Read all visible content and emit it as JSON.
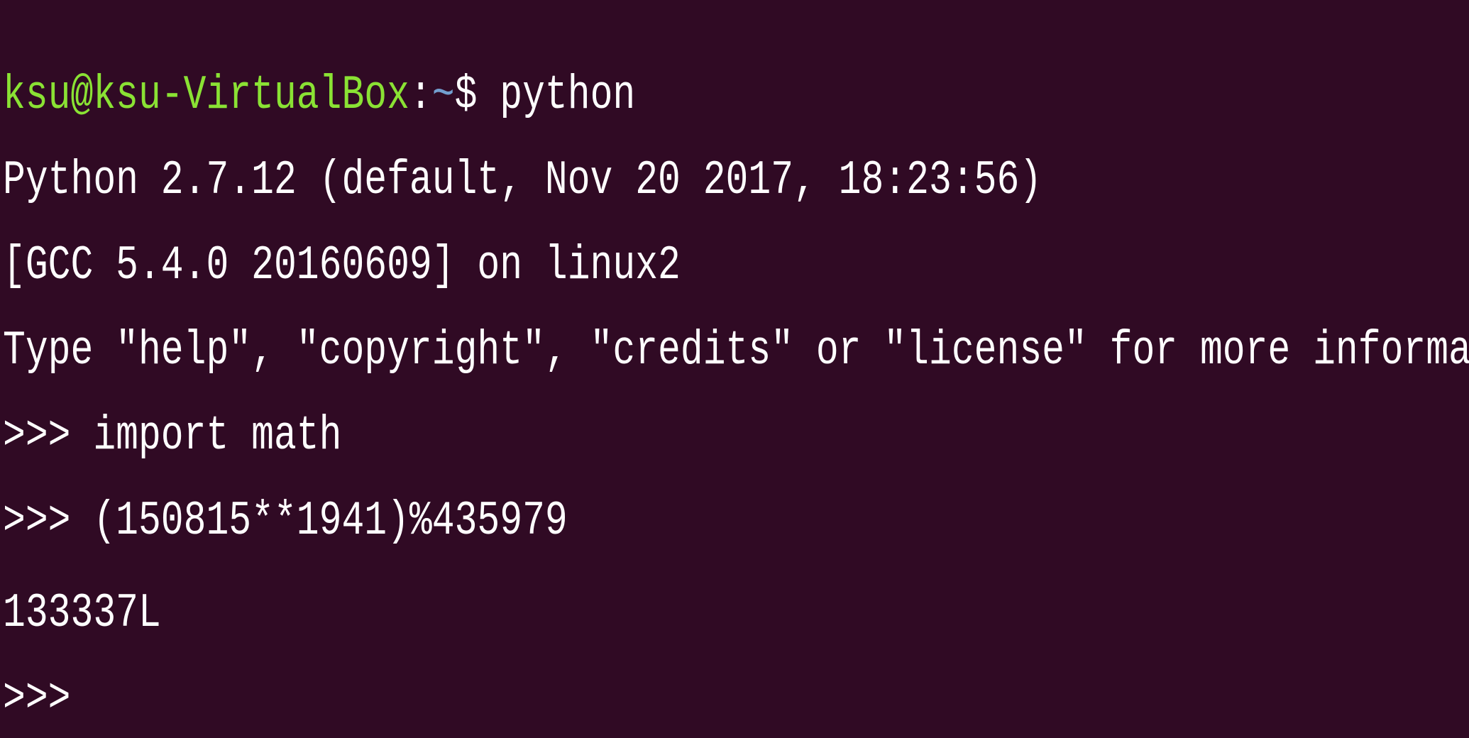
{
  "terminal": {
    "background": "#300a24",
    "prompt": {
      "user_host": "ksu@ksu-VirtualBox",
      "colon": ":",
      "path": "~",
      "dollar": "$ ",
      "command": "python",
      "user_host_color": "#8ae234",
      "path_color": "#729fcf"
    },
    "lines": [
      "Python 2.7.12 (default, Nov 20 2017, 18:23:56)",
      "[GCC 5.4.0 20160609] on linux2",
      "Type \"help\", \"copyright\", \"credits\" or \"license\" for more information."
    ],
    "repl": {
      "prompt_symbol": ">>> ",
      "cmd1": "import math",
      "cmd2": "(150815**1941)%435979",
      "output": "133337L",
      "final_prompt": ">>>"
    }
  }
}
